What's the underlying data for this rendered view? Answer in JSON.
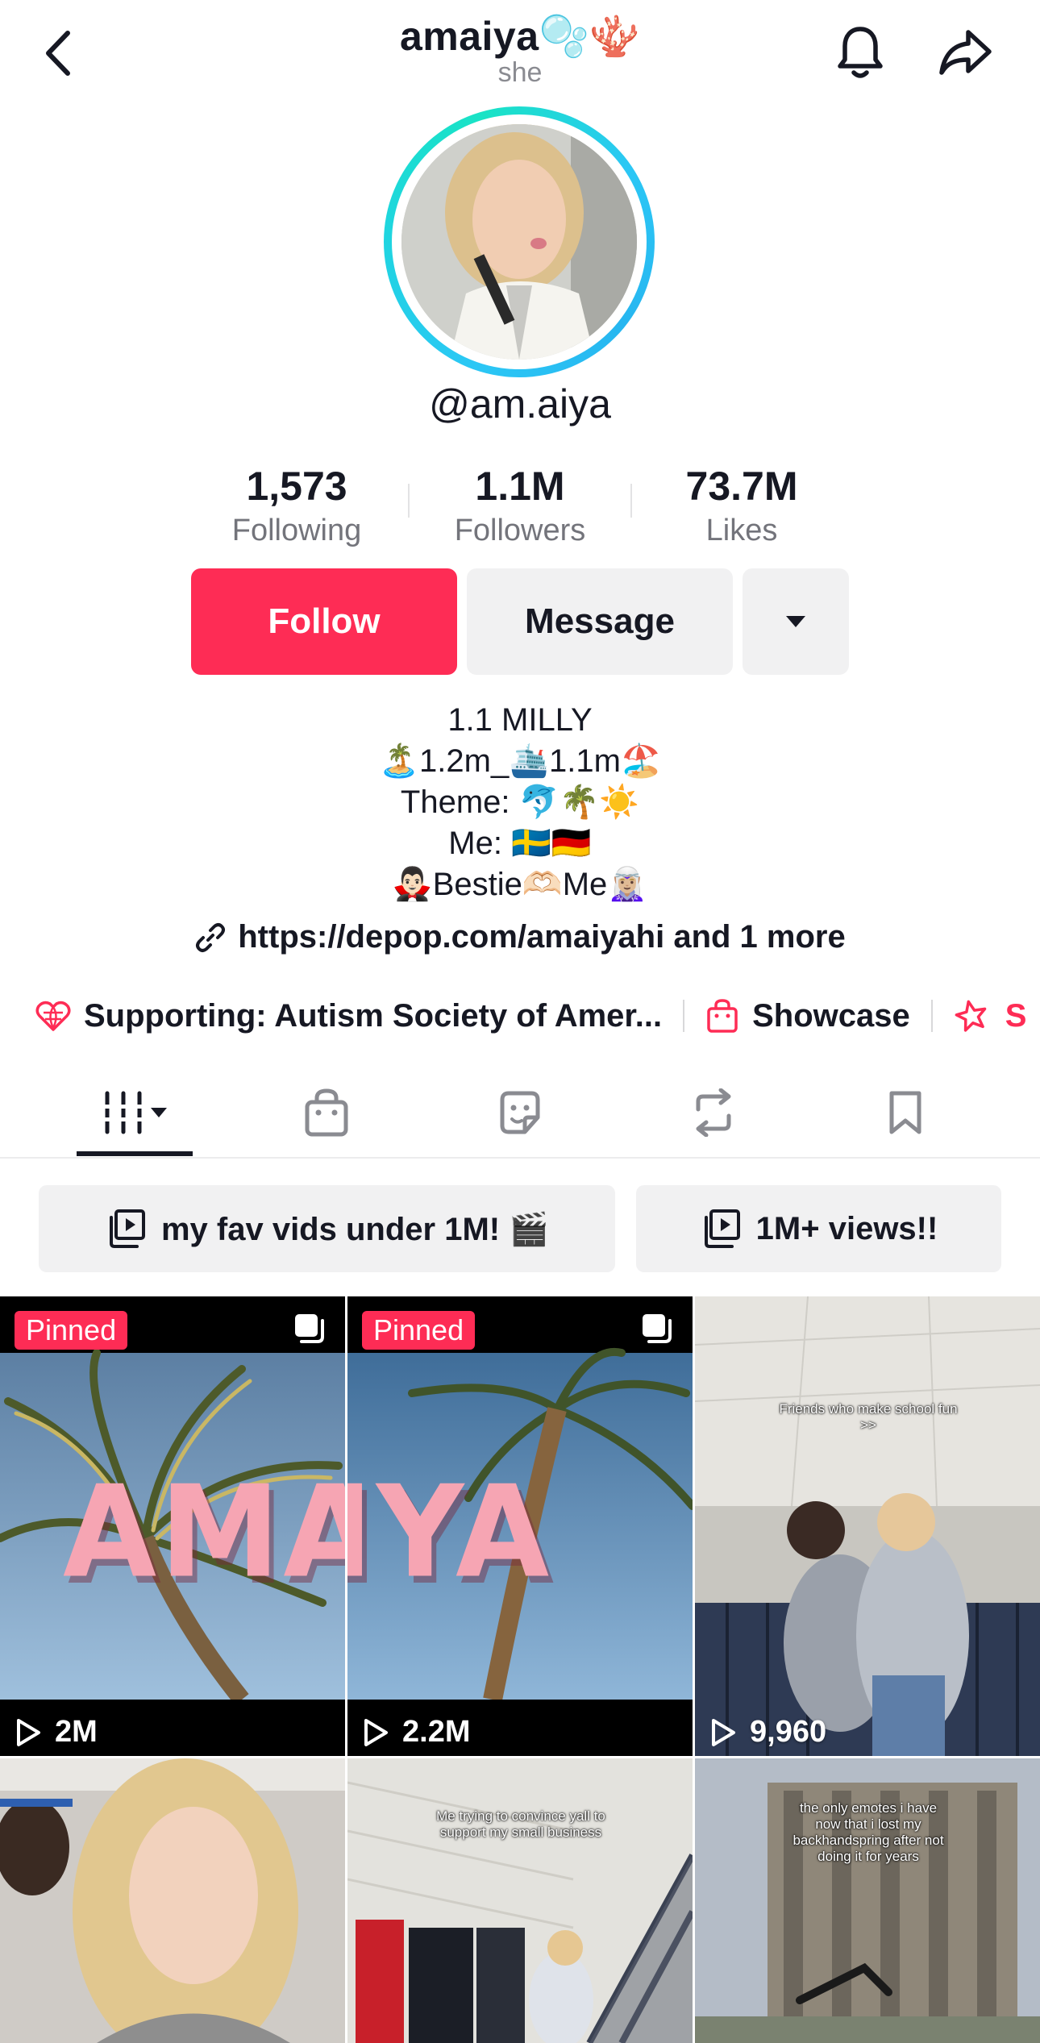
{
  "header": {
    "username": "amaiya🫧🪸",
    "pronoun": "she",
    "back_icon": "chevron-left-icon",
    "notification_icon": "bell-icon",
    "share_icon": "share-arrow-icon"
  },
  "profile": {
    "handle": "@am.aiya",
    "ring_color": "#2bc7f5"
  },
  "stats": [
    {
      "value": "1,573",
      "label": "Following"
    },
    {
      "value": "1.1M",
      "label": "Followers"
    },
    {
      "value": "73.7M",
      "label": "Likes"
    }
  ],
  "actions": {
    "follow": "Follow",
    "message": "Message",
    "follow_color": "#fe2c55"
  },
  "bio": {
    "lines": [
      "1.1 MILLY",
      "🏝️1.2m_🛳️1.1m🏖️",
      "Theme: 🐬🌴☀️",
      "Me: 🇸🇪🇩🇪",
      "🧛🏻‍♂️Bestie🫶🏻Me🧝🏼‍♀️"
    ],
    "link": "https://depop.com/amaiyahi and 1 more"
  },
  "chips": [
    {
      "icon": "heart-globe-icon",
      "label": "Supporting: Autism Society of Amer..."
    },
    {
      "icon": "shopping-bag-icon",
      "label": "Showcase"
    },
    {
      "icon": "star-icon",
      "label": "S"
    }
  ],
  "tabs": [
    {
      "icon": "videos-grid-icon"
    },
    {
      "icon": "shop-bag-icon"
    },
    {
      "icon": "sticker-icon"
    },
    {
      "icon": "repost-icon"
    },
    {
      "icon": "bookmark-icon"
    }
  ],
  "playlists": [
    {
      "label": "my fav vids under 1M! 🎬"
    },
    {
      "label": "1M+ views!!"
    }
  ],
  "videos": [
    {
      "pinned": "Pinned",
      "views": "2M",
      "overlay_text": "AMAI"
    },
    {
      "pinned": "Pinned",
      "views": "2.2M",
      "overlay_text": "IYA"
    },
    {
      "views": "9,960",
      "caption": "Friends who make school fun >>"
    },
    {
      "views": ""
    },
    {
      "caption": "Me trying to convince yall to support my small business"
    },
    {
      "caption": "the only emotes i have now that i lost my backhandspring after not doing it for years"
    }
  ]
}
